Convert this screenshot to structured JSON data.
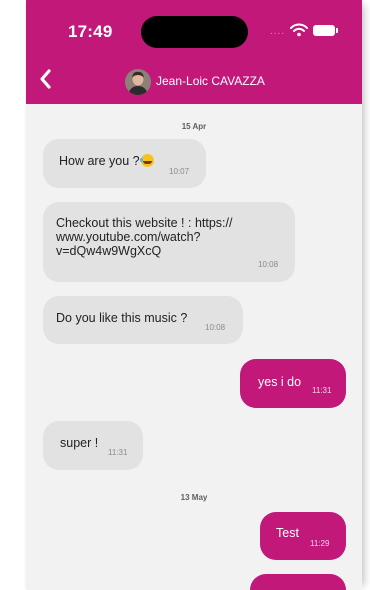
{
  "status_bar": {
    "time": "17:49",
    "signal": "....",
    "icons": [
      "wifi-icon",
      "battery-icon"
    ]
  },
  "header": {
    "contact_name": "Jean-Loic CAVAZZA",
    "back_icon": "chevron-left-icon"
  },
  "colors": {
    "accent": "#c2187a",
    "incoming_bubble": "#e2e2e2",
    "background": "#f2f2f2"
  },
  "chat": {
    "date_separators": [
      "15 Apr",
      "13 May"
    ],
    "messages": [
      {
        "direction": "incoming",
        "text": "How are you ?",
        "emoji": "tears-of-joy-emoji",
        "time": "10:07"
      },
      {
        "direction": "incoming",
        "lines": [
          "Checkout this website !  : https://",
          "www.youtube.com/watch?",
          "v=dQw4w9WgXcQ"
        ],
        "time": "10:08"
      },
      {
        "direction": "incoming",
        "text": "Do you like this music ?",
        "time": "10:08"
      },
      {
        "direction": "outgoing",
        "text": "yes i do",
        "time": "11:31"
      },
      {
        "direction": "incoming",
        "text": "super !",
        "time": "11:31"
      },
      {
        "direction": "outgoing",
        "text": "Test",
        "time": "11:29"
      }
    ]
  }
}
